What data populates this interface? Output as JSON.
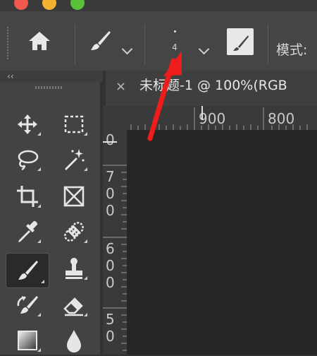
{
  "window": {
    "traffic_lights": [
      "close-button",
      "minimize-button",
      "zoom-button"
    ],
    "colors": {
      "close": "#ee5b4e",
      "minimize": "#f2b232",
      "zoom": "#59c13a"
    }
  },
  "options_bar": {
    "home_icon": "home-icon",
    "brush_preset_icon": "brush-icon",
    "brush_size_value": "4",
    "brush_panel_icon": "brush-settings-icon",
    "mode_label": "模式:"
  },
  "toolbar": {
    "collapse_label": "‹‹",
    "tools": [
      "move",
      "marquee",
      "lasso",
      "magic-wand",
      "crop",
      "frame",
      "eyedropper",
      "healing-brush",
      "brush",
      "clone-stamp",
      "history-brush",
      "eraser",
      "gradient",
      "blur"
    ],
    "active_tool": "brush"
  },
  "document": {
    "tab_close": "×",
    "tab_title": "未标题-1 @ 100%(RGB"
  },
  "rulers": {
    "top": [
      "900",
      "800"
    ],
    "left": [
      {
        "digits": [
          "0"
        ]
      },
      {
        "digits": [
          "7",
          "0",
          "0"
        ]
      },
      {
        "digits": [
          "6",
          "0",
          "0"
        ]
      },
      {
        "digits": [
          "5",
          "0"
        ]
      }
    ]
  },
  "annotation": {
    "arrow_color": "#ee1d1d"
  }
}
